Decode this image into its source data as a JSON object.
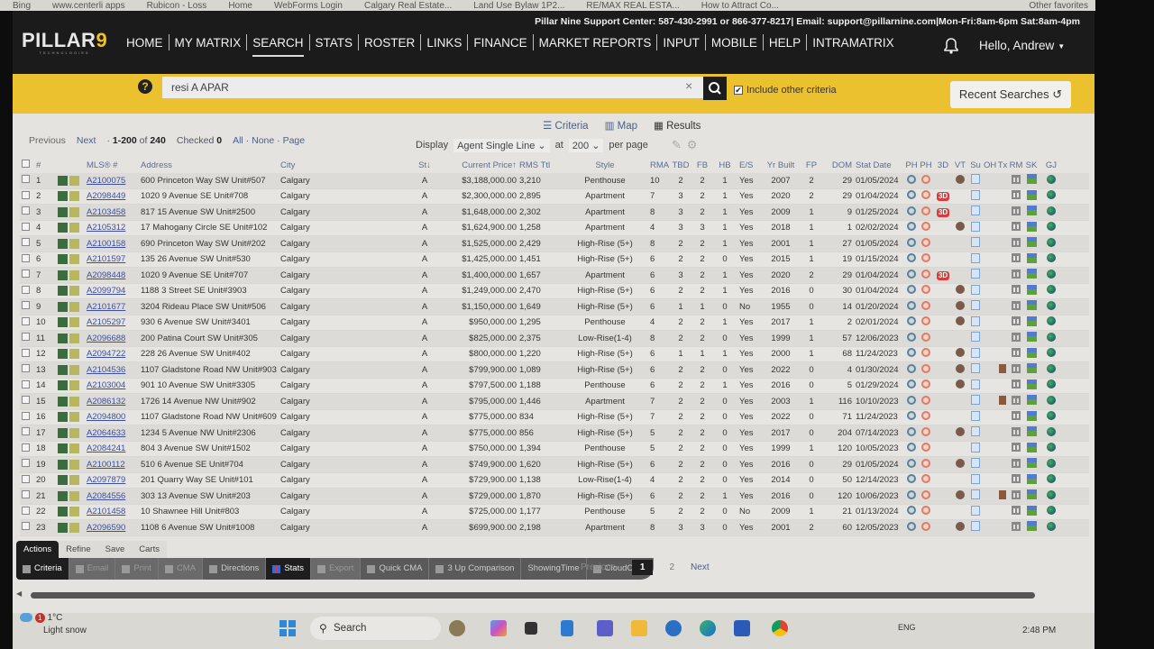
{
  "browser": {
    "bookmarks": [
      "Bing",
      "www.centerli apps",
      "Rubicon - Loss",
      "Home",
      "WebForms Login",
      "Calgary Real Estate...",
      "Land Use Bylaw 1P2...",
      "RE/MAX REAL ESTA...",
      "How to Attract Co..."
    ],
    "other_favorites": "Other favorites"
  },
  "header": {
    "support_text": "Pillar Nine Support Center: 587-430-2991 or 866-377-8217| Email: support@pillarnine.com|Mon-Fri:8am-6pm Sat:8am-4pm",
    "logo_main": "PILLAR",
    "logo_num": "9",
    "logo_sub": "TECHNOLOGIES",
    "nav": [
      "HOME",
      "MY MATRIX",
      "SEARCH",
      "STATS",
      "ROSTER",
      "LINKS",
      "FINANCE",
      "MARKET REPORTS",
      "INPUT",
      "MOBILE",
      "HELP",
      "INTRAMATRIX"
    ],
    "active_nav": "SEARCH",
    "greeting": "Hello, Andrew"
  },
  "search": {
    "help_glyph": "?",
    "query": "resi A APAR",
    "clear_glyph": "×",
    "include_other_label": "Include other criteria",
    "include_other_checked": true,
    "recent_label": "Recent Searches"
  },
  "view_tabs": {
    "criteria": "Criteria",
    "map": "Map",
    "results": "Results"
  },
  "pager": {
    "previous": "Previous",
    "next": "Next",
    "range": "1-200",
    "of_label": "of",
    "total": "240",
    "checked_label": "Checked",
    "checked_count": "0",
    "all": "All",
    "none": "None",
    "page": "Page",
    "display_label": "Display",
    "display_value": "Agent Single Line",
    "at_label": "at",
    "per_page_value": "200",
    "per_page_label": "per page"
  },
  "table": {
    "headers": {
      "num": "#",
      "mls": "MLS® #",
      "address": "Address",
      "city": "City",
      "st": "St↓",
      "price": "Current Price↑",
      "rms": "RMS Ttl",
      "style": "Style",
      "rma": "RMA",
      "tbd": "TBD",
      "fb": "FB",
      "hb": "HB",
      "es": "E/S",
      "yr": "Yr Built",
      "fp": "FP",
      "dom": "DOM",
      "date": "Stat Date",
      "ph1": "PH",
      "ph2": "PH",
      "d3": "3D",
      "vt": "VT",
      "su": "Su",
      "oh": "OH",
      "tx": "Tx",
      "rm": "RM",
      "sk": "SK",
      "gj": "GJ"
    },
    "rows": [
      {
        "n": "1",
        "mls": "A2100075",
        "addr": "600 Princeton Way SW Unit#507",
        "city": "Calgary",
        "st": "A",
        "price": "$3,188,000.00",
        "rms": "3,210",
        "style": "Penthouse",
        "rma": "10",
        "tbd": "2",
        "fb": "2",
        "hb": "1",
        "es": "Yes",
        "yr": "2007",
        "fp": "2",
        "dom": "29",
        "date": "01/05/2024",
        "d3": false,
        "vt": true,
        "tx": false
      },
      {
        "n": "2",
        "mls": "A2098449",
        "addr": "1020 9 Avenue SE Unit#708",
        "city": "Calgary",
        "st": "A",
        "price": "$2,300,000.00",
        "rms": "2,895",
        "style": "Apartment",
        "rma": "7",
        "tbd": "3",
        "fb": "2",
        "hb": "1",
        "es": "Yes",
        "yr": "2020",
        "fp": "2",
        "dom": "29",
        "date": "01/04/2024",
        "d3": true,
        "vt": false,
        "tx": false
      },
      {
        "n": "3",
        "mls": "A2103458",
        "addr": "817 15 Avenue SW Unit#2500",
        "city": "Calgary",
        "st": "A",
        "price": "$1,648,000.00",
        "rms": "2,302",
        "style": "Apartment",
        "rma": "8",
        "tbd": "3",
        "fb": "2",
        "hb": "1",
        "es": "Yes",
        "yr": "2009",
        "fp": "1",
        "dom": "9",
        "date": "01/25/2024",
        "d3": true,
        "vt": false,
        "tx": false
      },
      {
        "n": "4",
        "mls": "A2105312",
        "addr": "17 Mahogany Circle SE Unit#102",
        "city": "Calgary",
        "st": "A",
        "price": "$1,624,900.00",
        "rms": "1,258",
        "style": "Apartment",
        "rma": "4",
        "tbd": "3",
        "fb": "3",
        "hb": "1",
        "es": "Yes",
        "yr": "2018",
        "fp": "1",
        "dom": "1",
        "date": "02/02/2024",
        "d3": false,
        "vt": true,
        "tx": false
      },
      {
        "n": "5",
        "mls": "A2100158",
        "addr": "690 Princeton Way SW Unit#202",
        "city": "Calgary",
        "st": "A",
        "price": "$1,525,000.00",
        "rms": "2,429",
        "style": "High-Rise (5+)",
        "rma": "8",
        "tbd": "2",
        "fb": "2",
        "hb": "1",
        "es": "Yes",
        "yr": "2001",
        "fp": "1",
        "dom": "27",
        "date": "01/05/2024",
        "d3": false,
        "vt": false,
        "tx": false
      },
      {
        "n": "6",
        "mls": "A2101597",
        "addr": "135 26 Avenue SW Unit#530",
        "city": "Calgary",
        "st": "A",
        "price": "$1,425,000.00",
        "rms": "1,451",
        "style": "High-Rise (5+)",
        "rma": "6",
        "tbd": "2",
        "fb": "2",
        "hb": "0",
        "es": "Yes",
        "yr": "2015",
        "fp": "1",
        "dom": "19",
        "date": "01/15/2024",
        "d3": false,
        "vt": false,
        "tx": false
      },
      {
        "n": "7",
        "mls": "A2098448",
        "addr": "1020 9 Avenue SE Unit#707",
        "city": "Calgary",
        "st": "A",
        "price": "$1,400,000.00",
        "rms": "1,657",
        "style": "Apartment",
        "rma": "6",
        "tbd": "3",
        "fb": "2",
        "hb": "1",
        "es": "Yes",
        "yr": "2020",
        "fp": "2",
        "dom": "29",
        "date": "01/04/2024",
        "d3": true,
        "vt": false,
        "tx": false
      },
      {
        "n": "8",
        "mls": "A2099794",
        "addr": "1188 3 Street SE Unit#3903",
        "city": "Calgary",
        "st": "A",
        "price": "$1,249,000.00",
        "rms": "2,470",
        "style": "High-Rise (5+)",
        "rma": "6",
        "tbd": "2",
        "fb": "2",
        "hb": "1",
        "es": "Yes",
        "yr": "2016",
        "fp": "0",
        "dom": "30",
        "date": "01/04/2024",
        "d3": false,
        "vt": true,
        "tx": false
      },
      {
        "n": "9",
        "mls": "A2101677",
        "addr": "3204 Rideau Place SW Unit#506",
        "city": "Calgary",
        "st": "A",
        "price": "$1,150,000.00",
        "rms": "1,649",
        "style": "High-Rise (5+)",
        "rma": "6",
        "tbd": "1",
        "fb": "1",
        "hb": "0",
        "es": "No",
        "yr": "1955",
        "fp": "0",
        "dom": "14",
        "date": "01/20/2024",
        "d3": false,
        "vt": true,
        "tx": false
      },
      {
        "n": "10",
        "mls": "A2105297",
        "addr": "930 6 Avenue SW Unit#3401",
        "city": "Calgary",
        "st": "A",
        "price": "$950,000.00",
        "rms": "1,295",
        "style": "Penthouse",
        "rma": "4",
        "tbd": "2",
        "fb": "2",
        "hb": "1",
        "es": "Yes",
        "yr": "2017",
        "fp": "1",
        "dom": "2",
        "date": "02/01/2024",
        "d3": false,
        "vt": true,
        "tx": false
      },
      {
        "n": "11",
        "mls": "A2096688",
        "addr": "200 Patina Court SW Unit#305",
        "city": "Calgary",
        "st": "A",
        "price": "$825,000.00",
        "rms": "2,375",
        "style": "Low-Rise(1-4)",
        "rma": "8",
        "tbd": "2",
        "fb": "2",
        "hb": "0",
        "es": "Yes",
        "yr": "1999",
        "fp": "1",
        "dom": "57",
        "date": "12/06/2023",
        "d3": false,
        "vt": false,
        "tx": false
      },
      {
        "n": "12",
        "mls": "A2094722",
        "addr": "228 26 Avenue SW Unit#402",
        "city": "Calgary",
        "st": "A",
        "price": "$800,000.00",
        "rms": "1,220",
        "style": "High-Rise (5+)",
        "rma": "6",
        "tbd": "1",
        "fb": "1",
        "hb": "1",
        "es": "Yes",
        "yr": "2000",
        "fp": "1",
        "dom": "68",
        "date": "11/24/2023",
        "d3": false,
        "vt": true,
        "tx": false
      },
      {
        "n": "13",
        "mls": "A2104536",
        "addr": "1107 Gladstone Road NW Unit#903",
        "city": "Calgary",
        "st": "A",
        "price": "$799,900.00",
        "rms": "1,089",
        "style": "High-Rise (5+)",
        "rma": "6",
        "tbd": "2",
        "fb": "2",
        "hb": "0",
        "es": "Yes",
        "yr": "2022",
        "fp": "0",
        "dom": "4",
        "date": "01/30/2024",
        "d3": false,
        "vt": true,
        "tx": true
      },
      {
        "n": "14",
        "mls": "A2103004",
        "addr": "901 10 Avenue SW Unit#3305",
        "city": "Calgary",
        "st": "A",
        "price": "$797,500.00",
        "rms": "1,188",
        "style": "Penthouse",
        "rma": "6",
        "tbd": "2",
        "fb": "2",
        "hb": "1",
        "es": "Yes",
        "yr": "2016",
        "fp": "0",
        "dom": "5",
        "date": "01/29/2024",
        "d3": false,
        "vt": true,
        "tx": false
      },
      {
        "n": "15",
        "mls": "A2086132",
        "addr": "1726 14 Avenue NW Unit#902",
        "city": "Calgary",
        "st": "A",
        "price": "$795,000.00",
        "rms": "1,446",
        "style": "Apartment",
        "rma": "7",
        "tbd": "2",
        "fb": "2",
        "hb": "0",
        "es": "Yes",
        "yr": "2003",
        "fp": "1",
        "dom": "116",
        "date": "10/10/2023",
        "d3": false,
        "vt": false,
        "tx": true
      },
      {
        "n": "16",
        "mls": "A2094800",
        "addr": "1107 Gladstone Road NW Unit#609",
        "city": "Calgary",
        "st": "A",
        "price": "$775,000.00",
        "rms": "834",
        "style": "High-Rise (5+)",
        "rma": "7",
        "tbd": "2",
        "fb": "2",
        "hb": "0",
        "es": "Yes",
        "yr": "2022",
        "fp": "0",
        "dom": "71",
        "date": "11/24/2023",
        "d3": false,
        "vt": false,
        "tx": false
      },
      {
        "n": "17",
        "mls": "A2064633",
        "addr": "1234 5 Avenue NW Unit#2306",
        "city": "Calgary",
        "st": "A",
        "price": "$775,000.00",
        "rms": "856",
        "style": "High-Rise (5+)",
        "rma": "5",
        "tbd": "2",
        "fb": "2",
        "hb": "0",
        "es": "Yes",
        "yr": "2017",
        "fp": "0",
        "dom": "204",
        "date": "07/14/2023",
        "d3": false,
        "vt": true,
        "tx": false
      },
      {
        "n": "18",
        "mls": "A2084241",
        "addr": "804 3 Avenue SW Unit#1502",
        "city": "Calgary",
        "st": "A",
        "price": "$750,000.00",
        "rms": "1,394",
        "style": "Penthouse",
        "rma": "5",
        "tbd": "2",
        "fb": "2",
        "hb": "0",
        "es": "Yes",
        "yr": "1999",
        "fp": "1",
        "dom": "120",
        "date": "10/05/2023",
        "d3": false,
        "vt": false,
        "tx": false
      },
      {
        "n": "19",
        "mls": "A2100112",
        "addr": "510 6 Avenue SE Unit#704",
        "city": "Calgary",
        "st": "A",
        "price": "$749,900.00",
        "rms": "1,620",
        "style": "High-Rise (5+)",
        "rma": "6",
        "tbd": "2",
        "fb": "2",
        "hb": "0",
        "es": "Yes",
        "yr": "2016",
        "fp": "0",
        "dom": "29",
        "date": "01/05/2024",
        "d3": false,
        "vt": true,
        "tx": false
      },
      {
        "n": "20",
        "mls": "A2097879",
        "addr": "201 Quarry Way SE Unit#101",
        "city": "Calgary",
        "st": "A",
        "price": "$729,900.00",
        "rms": "1,138",
        "style": "Low-Rise(1-4)",
        "rma": "4",
        "tbd": "2",
        "fb": "2",
        "hb": "0",
        "es": "Yes",
        "yr": "2014",
        "fp": "0",
        "dom": "50",
        "date": "12/14/2023",
        "d3": false,
        "vt": false,
        "tx": false
      },
      {
        "n": "21",
        "mls": "A2084556",
        "addr": "303 13 Avenue SW Unit#203",
        "city": "Calgary",
        "st": "A",
        "price": "$729,000.00",
        "rms": "1,870",
        "style": "High-Rise (5+)",
        "rma": "6",
        "tbd": "2",
        "fb": "2",
        "hb": "1",
        "es": "Yes",
        "yr": "2016",
        "fp": "0",
        "dom": "120",
        "date": "10/06/2023",
        "d3": false,
        "vt": true,
        "tx": true
      },
      {
        "n": "22",
        "mls": "A2101458",
        "addr": "10 Shawnee Hill Unit#803",
        "city": "Calgary",
        "st": "A",
        "price": "$725,000.00",
        "rms": "1,177",
        "style": "Penthouse",
        "rma": "5",
        "tbd": "2",
        "fb": "2",
        "hb": "0",
        "es": "No",
        "yr": "2009",
        "fp": "1",
        "dom": "21",
        "date": "01/13/2024",
        "d3": false,
        "vt": false,
        "tx": false
      },
      {
        "n": "23",
        "mls": "A2096590",
        "addr": "1108 6 Avenue SW Unit#1008",
        "city": "Calgary",
        "st": "A",
        "price": "$699,900.00",
        "rms": "2,198",
        "style": "Apartment",
        "rma": "8",
        "tbd": "3",
        "fb": "3",
        "hb": "0",
        "es": "Yes",
        "yr": "2001",
        "fp": "2",
        "dom": "60",
        "date": "12/05/2023",
        "d3": false,
        "vt": true,
        "tx": false
      }
    ],
    "d3_label": "3D"
  },
  "actions": {
    "tabs": [
      "Actions",
      "Refine",
      "Save",
      "Carts"
    ],
    "active_tab": "Actions",
    "buttons": [
      "Criteria",
      "Email",
      "Print",
      "CMA",
      "Directions",
      "Stats",
      "Export",
      "Quick CMA",
      "3 Up Comparison",
      "ShowingTime",
      "CloudCMA"
    ]
  },
  "pagination": {
    "previous": "Previous",
    "current": "1",
    "page2": "2",
    "next": "Next"
  },
  "taskbar": {
    "weather_badge": "1",
    "temperature": "1°C",
    "condition": "Light snow",
    "search_label": "Search",
    "language": "ENG",
    "time": "2:48 PM"
  }
}
